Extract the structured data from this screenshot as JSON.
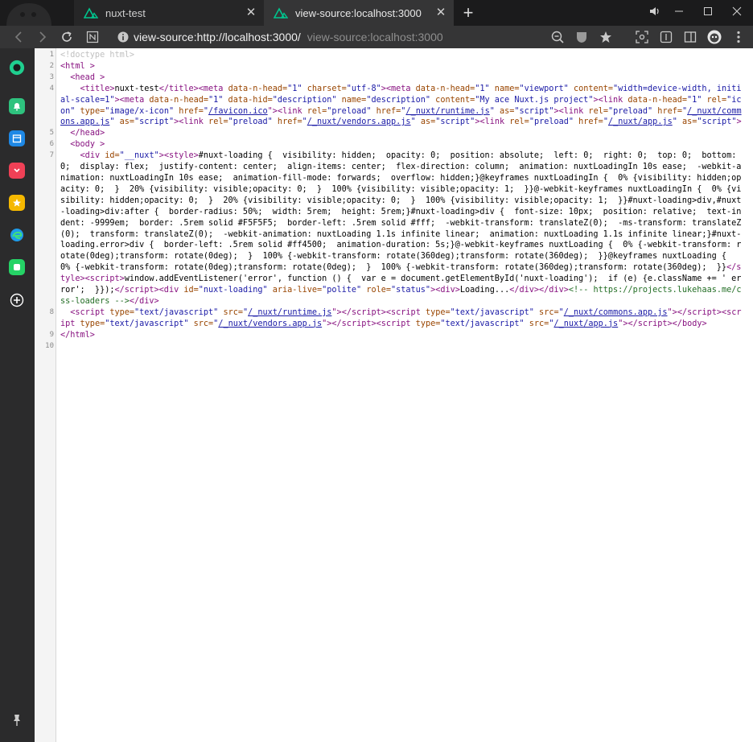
{
  "tabs": [
    {
      "title": "nuxt-test",
      "active": false
    },
    {
      "title": "view-source:localhost:3000",
      "active": true
    }
  ],
  "toolbar": {
    "url": "view-source:http://localhost:3000/",
    "page_title": "view-source:localhost:3000"
  },
  "sidebar": {
    "items": [
      {
        "name": "vpn-icon",
        "color": "#1fcf8f"
      },
      {
        "name": "notification-icon",
        "color": "#2ec27e"
      },
      {
        "name": "calendar-icon",
        "color": "#1e88e5"
      },
      {
        "name": "pocket-icon",
        "color": "#ef4056"
      },
      {
        "name": "bookmark-star-icon",
        "color": "#f5b800"
      },
      {
        "name": "edge-icon",
        "color": "#1e9be9"
      },
      {
        "name": "whatsapp-icon",
        "color": "#25d366"
      },
      {
        "name": "add-panel-icon",
        "color": "#ffffff"
      },
      {
        "name": "pin-icon",
        "color": "#cccccc"
      }
    ]
  },
  "source": {
    "line_numbers": [
      "1",
      "2",
      "3",
      "4",
      "5",
      "6",
      "7",
      "8",
      "9",
      "10"
    ],
    "l1": "<!doctype html>",
    "l2_tag": "<html >",
    "l3_tag": "<head >",
    "l4": {
      "title_open": "<title>",
      "title_text": "nuxt-test",
      "title_close": "</title>",
      "meta1_tag": "<meta",
      "meta1_a1": " data-n-head=",
      "meta1_v1": "\"1\"",
      "meta1_a2": " charset=",
      "meta1_v2": "\"utf-8\"",
      "meta1_end": ">",
      "meta2_tag": "<meta",
      "meta2_a1": " data-n-head=",
      "meta2_v1": "\"1\"",
      "meta2_a2": " name=",
      "meta2_v2": "\"viewport\"",
      "meta2_a3": " content=",
      "meta2_v3": "\"width=device-width, initial-scale=1\"",
      "meta2_end": ">",
      "meta3_tag": "<meta",
      "meta3_a1": " data-n-head=",
      "meta3_v1": "\"1\"",
      "meta3_a2": " data-hid=",
      "meta3_v2": "\"description\"",
      "meta3_a3": " name=",
      "meta3_v3": "\"description\"",
      "meta3_a4": " content=",
      "meta3_v4": "\"My ace Nuxt.js project\"",
      "meta3_end": ">",
      "link1_tag": "<link",
      "link1_a1": " data-n-head=",
      "link1_v1": "\"1\"",
      "link1_a2": " rel=",
      "link1_v2": "\"icon\"",
      "link1_a3": " type=",
      "link1_v3": "\"image/x-icon\"",
      "link1_a4": " href=",
      "link1_q": "\"",
      "link1_href": "/favicon.ico",
      "link1_end": "\">",
      "link2_tag": "<link",
      "link2_a1": " rel=",
      "link2_v1": "\"preload\"",
      "link2_a2": " href=",
      "link2_href": "/_nuxt/runtime.js",
      "link2_a3": " as=",
      "link2_v3": "\"script\"",
      "link3_href": "/_nuxt/commons.app.js",
      "link4_href": "/_nuxt/vendors.app.js",
      "link5_href": "/_nuxt/app.js"
    },
    "l5_tag": "</head>",
    "l6_tag": "<body >",
    "l7": {
      "div_open": "<div",
      "div_a1": " id=",
      "div_v1": "\"__nuxt\"",
      "div_end": ">",
      "style_open": "<style>",
      "css": "#nuxt-loading {  visibility: hidden;  opacity: 0;  position: absolute;  left: 0;  right: 0;  top: 0;  bottom: 0;  display: flex;  justify-content: center;  align-items: center;  flex-direction: column;  animation: nuxtLoadingIn 10s ease;  -webkit-animation: nuxtLoadingIn 10s ease;  animation-fill-mode: forwards;  overflow: hidden;}@keyframes nuxtLoadingIn {  0% {visibility: hidden;opacity: 0;  }  20% {visibility: visible;opacity: 0;  }  100% {visibility: visible;opacity: 1;  }}@-webkit-keyframes nuxtLoadingIn {  0% {visibility: hidden;opacity: 0;  }  20% {visibility: visible;opacity: 0;  }  100% {visibility: visible;opacity: 1;  }}#nuxt-loading>div,#nuxt-loading>div:after {  border-radius: 50%;  width: 5rem;  height: 5rem;}#nuxt-loading>div {  font-size: 10px;  position: relative;  text-indent: -9999em;  border: .5rem solid #F5F5F5;  border-left: .5rem solid #fff;  -webkit-transform: translateZ(0);  -ms-transform: translateZ(0);  transform: translateZ(0);  -webkit-animation: nuxtLoading 1.1s infinite linear;  animation: nuxtLoading 1.1s infinite linear;}#nuxt-loading.error>div {  border-left: .5rem solid #ff4500;  animation-duration: 5s;}@-webkit-keyframes nuxtLoading {  0% {-webkit-transform: rotate(0deg);transform: rotate(0deg);  }  100% {-webkit-transform: rotate(360deg);transform: rotate(360deg);  }}@keyframes nuxtLoading {  0% {-webkit-transform: rotate(0deg);transform: rotate(0deg);  }  100% {-webkit-transform: rotate(360deg);transform: rotate(360deg);  }}",
      "style_close": "</style>",
      "script_open": "<script>",
      "js": "window.addEventListener('error', function () {  var e = document.getElementById('nuxt-loading');  if (e) {e.className += ' error';  }});",
      "script_close": "</scr' + 'ipt>",
      "div2_open": "<div",
      "div2_a1": " id=",
      "div2_v1": "\"nuxt-loading\"",
      "div2_a2": " aria-live=",
      "div2_v2": "\"polite\"",
      "div2_a3": " role=",
      "div2_v3": "\"status\"",
      "div2_end": ">",
      "div3": "<div>",
      "loading_text": "Loading...",
      "div3_close": "</div></div>",
      "comment": "<!-- https://projects.lukehaas.me/css-loaders -->",
      "div_close": "</div>"
    },
    "l8": {
      "script_tag": "<script",
      "a_type": " type=",
      "v_type": "\"text/javascript\"",
      "a_src": " src=",
      "q": "\"",
      "src1": "/_nuxt/runtime.js",
      "src2": "/_nuxt/commons.app.js",
      "src3": "/_nuxt/vendors.app.js",
      "src4": "/_nuxt/app.js",
      "end": "\">",
      "close": "</scr' + 'ipt>",
      "body_close": "</body>"
    },
    "l9_tag": "</html>"
  }
}
